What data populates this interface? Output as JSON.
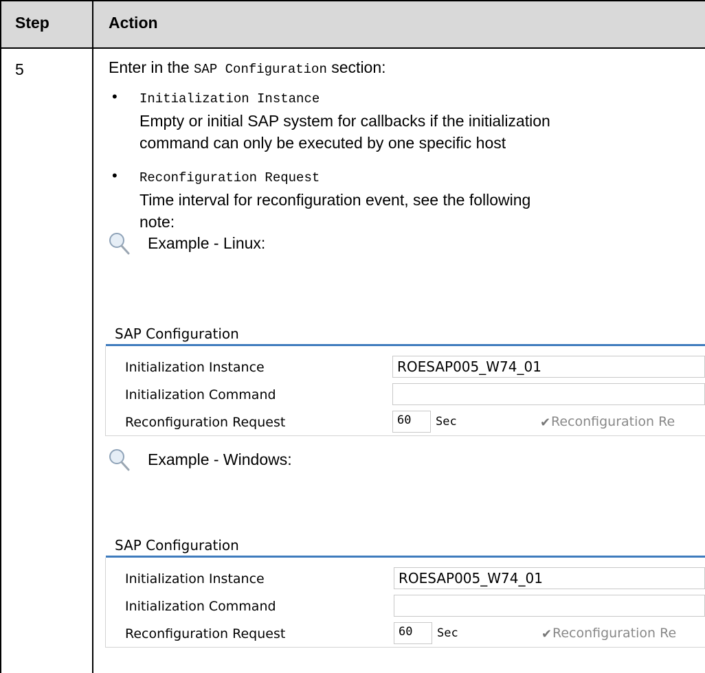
{
  "table": {
    "headers": [
      "Step",
      "Action"
    ],
    "step": "5",
    "intro_prefix": "Enter in the ",
    "intro_code": "SAP Configuration",
    "intro_suffix": " section:",
    "bullets": [
      {
        "code": "Initialization Instance",
        "lines": [
          "Empty or initial SAP system for callbacks if the initialization",
          "command can only be executed by one specific host"
        ]
      },
      {
        "code": "Reconfiguration Request",
        "lines": [
          "Time interval for reconfiguration event, see the following",
          "note:"
        ]
      }
    ],
    "examples": [
      {
        "label": "Example - Linux:",
        "panel": {
          "title": "SAP Configuration",
          "labels": [
            "Initialization Instance",
            "Initialization Command",
            "Reconfiguration Request"
          ],
          "instance_value": "ROESAP005_W74_01",
          "command_value": "",
          "interval_value": "60",
          "unit": "Sec",
          "checkbox_label": "Reconfiguration Re",
          "checked": true
        }
      },
      {
        "label": "Example - Windows:",
        "panel": {
          "title": "SAP Configuration",
          "labels": [
            "Initialization Instance",
            "Initialization Command",
            "Reconfiguration Request"
          ],
          "instance_value": "ROESAP005_W74_01",
          "command_value": "",
          "interval_value": "60",
          "unit": "Sec",
          "checkbox_label": "Reconfiguration Re",
          "checked": true
        }
      }
    ]
  },
  "colors": {
    "header_bg": "#d9d9d9",
    "panel_accent": "#3e7bbd"
  },
  "icons": [
    "magnifier-icon",
    "check-icon"
  ]
}
